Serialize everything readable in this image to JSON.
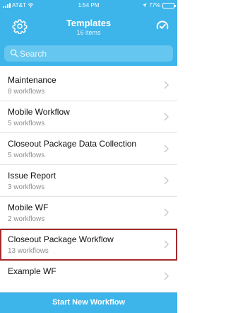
{
  "status": {
    "carrier": "AT&T",
    "time": "1:54 PM",
    "battery": "77%",
    "battery_level": 0.77
  },
  "header": {
    "title": "Templates",
    "subtitle": "16 items",
    "settings_icon": "gear-icon",
    "sync_icon": "sync-icon"
  },
  "search": {
    "placeholder": "Search",
    "value": ""
  },
  "colors": {
    "accent": "#3db4ea",
    "highlight_border": "#a52a2a"
  },
  "templates": [
    {
      "name": "Maintenance",
      "count": "8 workflows"
    },
    {
      "name": "Mobile Workflow",
      "count": "5 workflows"
    },
    {
      "name": "Closeout Package Data Collection",
      "count": "5 workflows"
    },
    {
      "name": "Issue Report",
      "count": "3 workflows"
    },
    {
      "name": "Mobile WF",
      "count": "2 workflows"
    },
    {
      "name": "Closeout Package Workflow",
      "count": "13 workflows",
      "highlighted": true
    },
    {
      "name": "Example WF",
      "count": ""
    }
  ],
  "footer": {
    "start_label": "Start New Workflow"
  }
}
